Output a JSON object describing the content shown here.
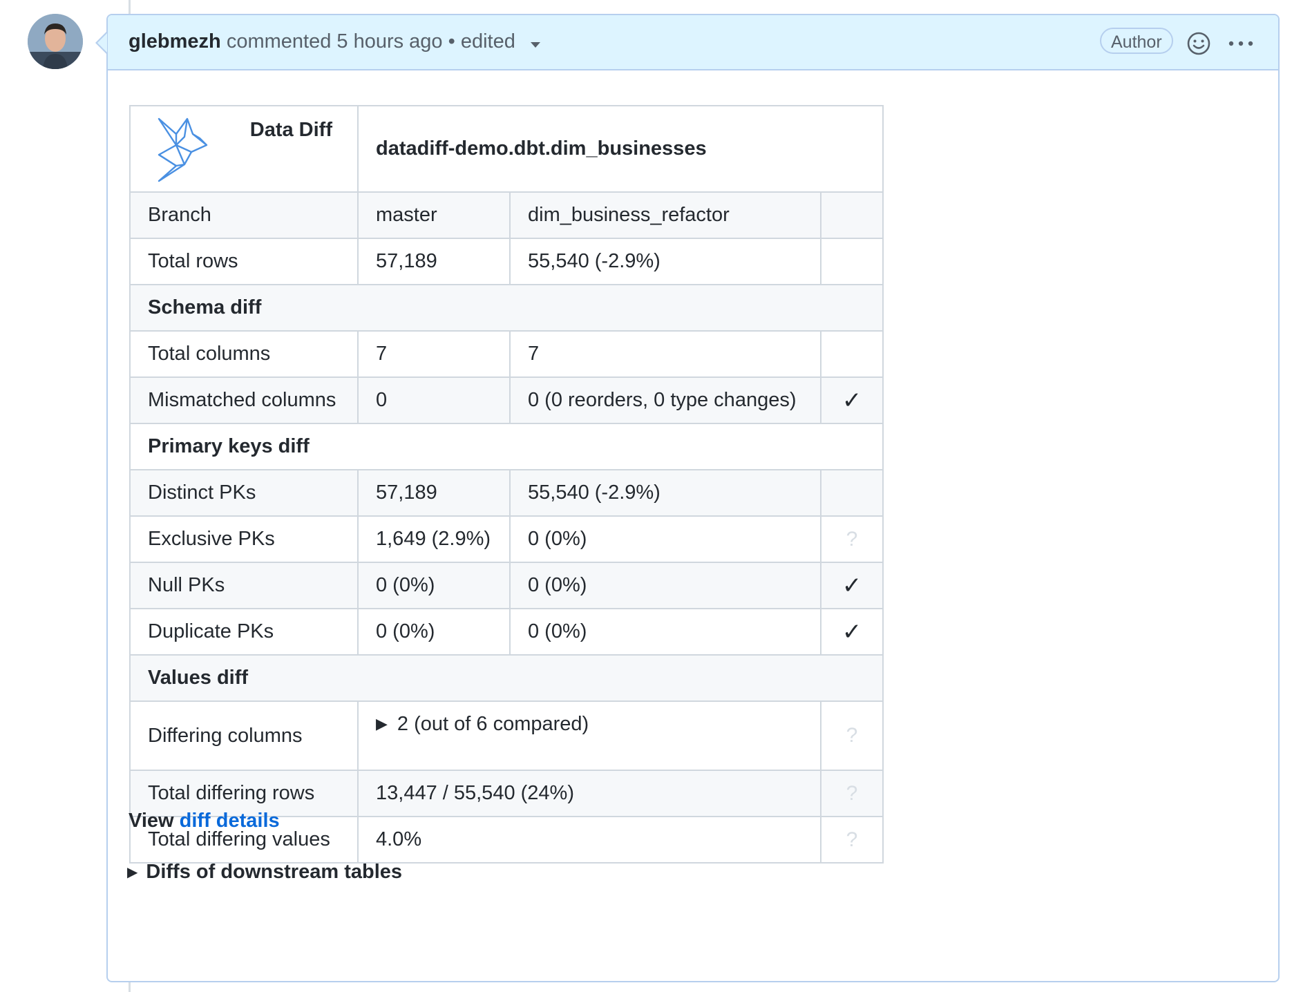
{
  "comment": {
    "author": "glebmezh",
    "action": "commented",
    "time": "5 hours ago",
    "separator": "•",
    "edited": "edited",
    "badge": "Author"
  },
  "report": {
    "logo_title": "Data Diff",
    "table_name": "datadiff-demo.dbt.dim_businesses",
    "rows": [
      {
        "label": "Branch",
        "c1": "master",
        "c2": "dim_business_refactor",
        "status": ""
      },
      {
        "label": "Total rows",
        "c1": "57,189",
        "c2": "55,540 (-2.9%)",
        "status": ""
      },
      {
        "section": "Schema diff"
      },
      {
        "label": "Total columns",
        "c1": "7",
        "c2": "7",
        "status": ""
      },
      {
        "label": "Mismatched columns",
        "c1": "0",
        "c2": "0 (0 reorders, 0 type changes)",
        "status": "✓"
      },
      {
        "section": "Primary keys diff"
      },
      {
        "label": "Distinct PKs",
        "c1": "57,189",
        "c2": "55,540 (-2.9%)",
        "status": ""
      },
      {
        "label": "Exclusive PKs",
        "c1": "1,649 (2.9%)",
        "c2": "0 (0%)",
        "status": "?"
      },
      {
        "label": "Null PKs",
        "c1": "0 (0%)",
        "c2": "0 (0%)",
        "status": "✓"
      },
      {
        "label": "Duplicate PKs",
        "c1": "0 (0%)",
        "c2": "0 (0%)",
        "status": "✓"
      },
      {
        "section": "Values diff"
      },
      {
        "label": "Differing columns",
        "value": "2 (out of 6 compared)",
        "status": "?"
      },
      {
        "label": "Total differing rows",
        "value": "13,447 / 55,540 (24%)",
        "status": "?"
      },
      {
        "label": "Total differing values",
        "value": "4.0%",
        "status": "?"
      }
    ]
  },
  "footer": {
    "view_prefix": "View",
    "view_link": "diff details",
    "downstream": "Diffs of downstream tables"
  }
}
